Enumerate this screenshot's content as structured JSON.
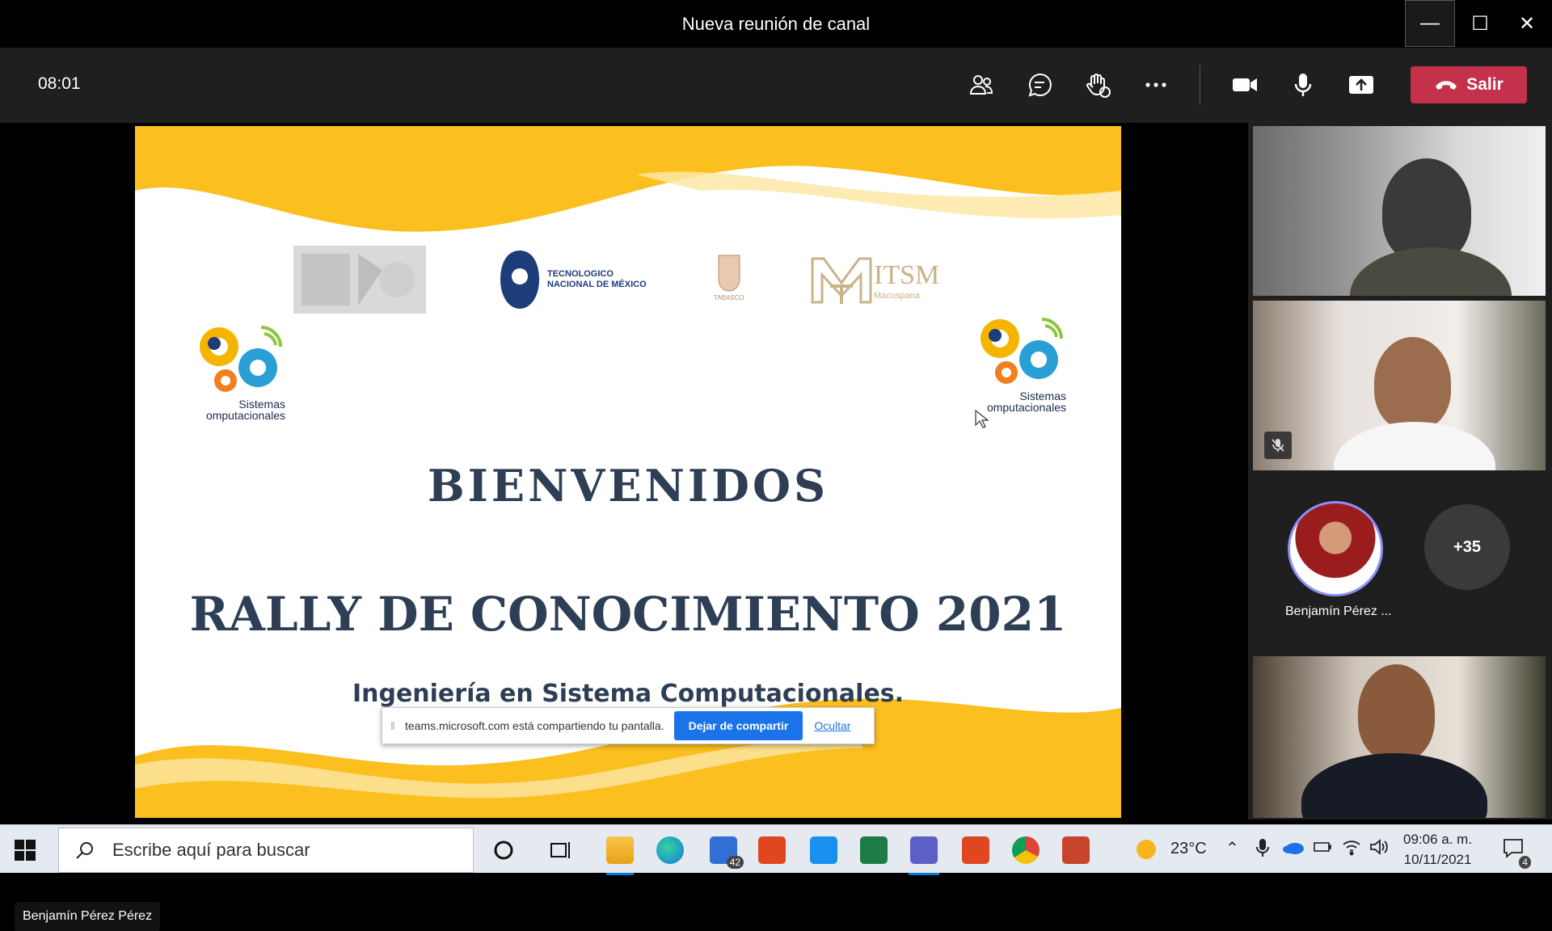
{
  "window": {
    "title": "Nueva reunión de canal"
  },
  "meeting": {
    "timer": "08:01",
    "leave_label": "Salir",
    "controls": [
      "participants-icon",
      "chat-icon",
      "reactions-icon",
      "more-icon",
      "camera-icon",
      "mic-icon",
      "share-icon"
    ]
  },
  "slide": {
    "tecnm_line1": "TECNOLOGICO",
    "tecnm_line2": "NACIONAL DE MÉXICO",
    "tabasco": "TABASCO",
    "itsm": "ITSM",
    "itsm_sub": "Macuspana",
    "sys_line1": "Sistemas",
    "sys_line2": "omputacionales",
    "welcome": "BIENVENIDOS",
    "title": "RALLY DE CONOCIMIENTO 2021",
    "subtitle": "Ingeniería en Sistema Computacionales."
  },
  "sharebar": {
    "message": "teams.microsoft.com está compartiendo tu pantalla.",
    "stop_label": "Dejar de compartir",
    "hide_label": "Ocultar"
  },
  "presenter": {
    "name": "Benjamín Pérez Pérez"
  },
  "participants": {
    "avatar_name": "Benjamín Pérez ...",
    "overflow": "+35"
  },
  "taskbar": {
    "search_placeholder": "Escribe aquí para buscar",
    "mail_badge": "42",
    "weather": "23°C",
    "time": "09:06 a. m.",
    "date": "10/11/2021",
    "notifications": "4"
  },
  "colors": {
    "leave": "#c4314b",
    "accent": "#1a73e8",
    "wave_yellow": "#fbbf1f",
    "slide_text": "#2d3e55"
  }
}
